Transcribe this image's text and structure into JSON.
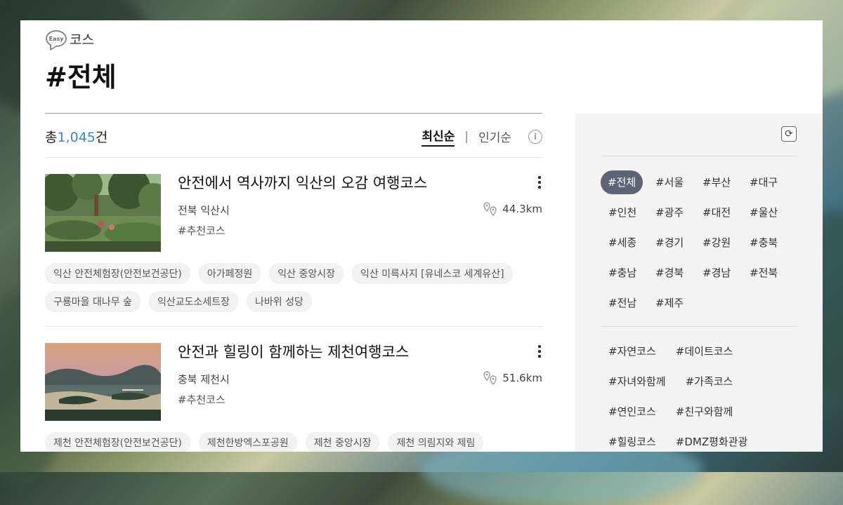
{
  "header": {
    "easy_badge": "Easy",
    "section_label": "코스",
    "title": "#전체"
  },
  "summary": {
    "prefix": "총",
    "count": "1,045",
    "suffix": "건",
    "sort_latest": "최신순",
    "sort_sep": "|",
    "sort_popular": "인기순",
    "info_glyph": "i"
  },
  "courses": [
    {
      "title": "안전에서 역사까지 익산의 오감 여행코스",
      "region": "전북 익산시",
      "tag": "#추천코스",
      "distance": "44.3km",
      "spots": [
        "익산 안전체험장(안전보건공단)",
        "아가페정원",
        "익산 중앙시장",
        "익산 미륵사지 [유네스코 세계유산]",
        "구룡마을 대나무 숲",
        "익산교도소세트장",
        "나바위 성당"
      ]
    },
    {
      "title": "안전과 힐링이 함께하는 제천여행코스",
      "region": "충북 제천시",
      "tag": "#추천코스",
      "distance": "51.6km",
      "spots": [
        "제천 안전체험장(안전보건공단)",
        "제천한방엑스포공원",
        "제천 중앙시장",
        "제천 의림지와 제림"
      ]
    }
  ],
  "filters": {
    "refresh_glyph": "⟳",
    "regions": [
      "#전체",
      "#서울",
      "#부산",
      "#대구",
      "#인천",
      "#광주",
      "#대전",
      "#울산",
      "#세종",
      "#경기",
      "#강원",
      "#충북",
      "#충남",
      "#경북",
      "#경남",
      "#전북",
      "#전남",
      "#제주"
    ],
    "themes": [
      "#자연코스",
      "#데이트코스",
      "#자녀와함께",
      "#가족코스",
      "#연인코스",
      "#친구와함께",
      "#힐링코스",
      "#DMZ평화관광"
    ]
  },
  "colors": {
    "accent_count": "#3b86c6",
    "active_tag_bg": "#5c6478"
  }
}
